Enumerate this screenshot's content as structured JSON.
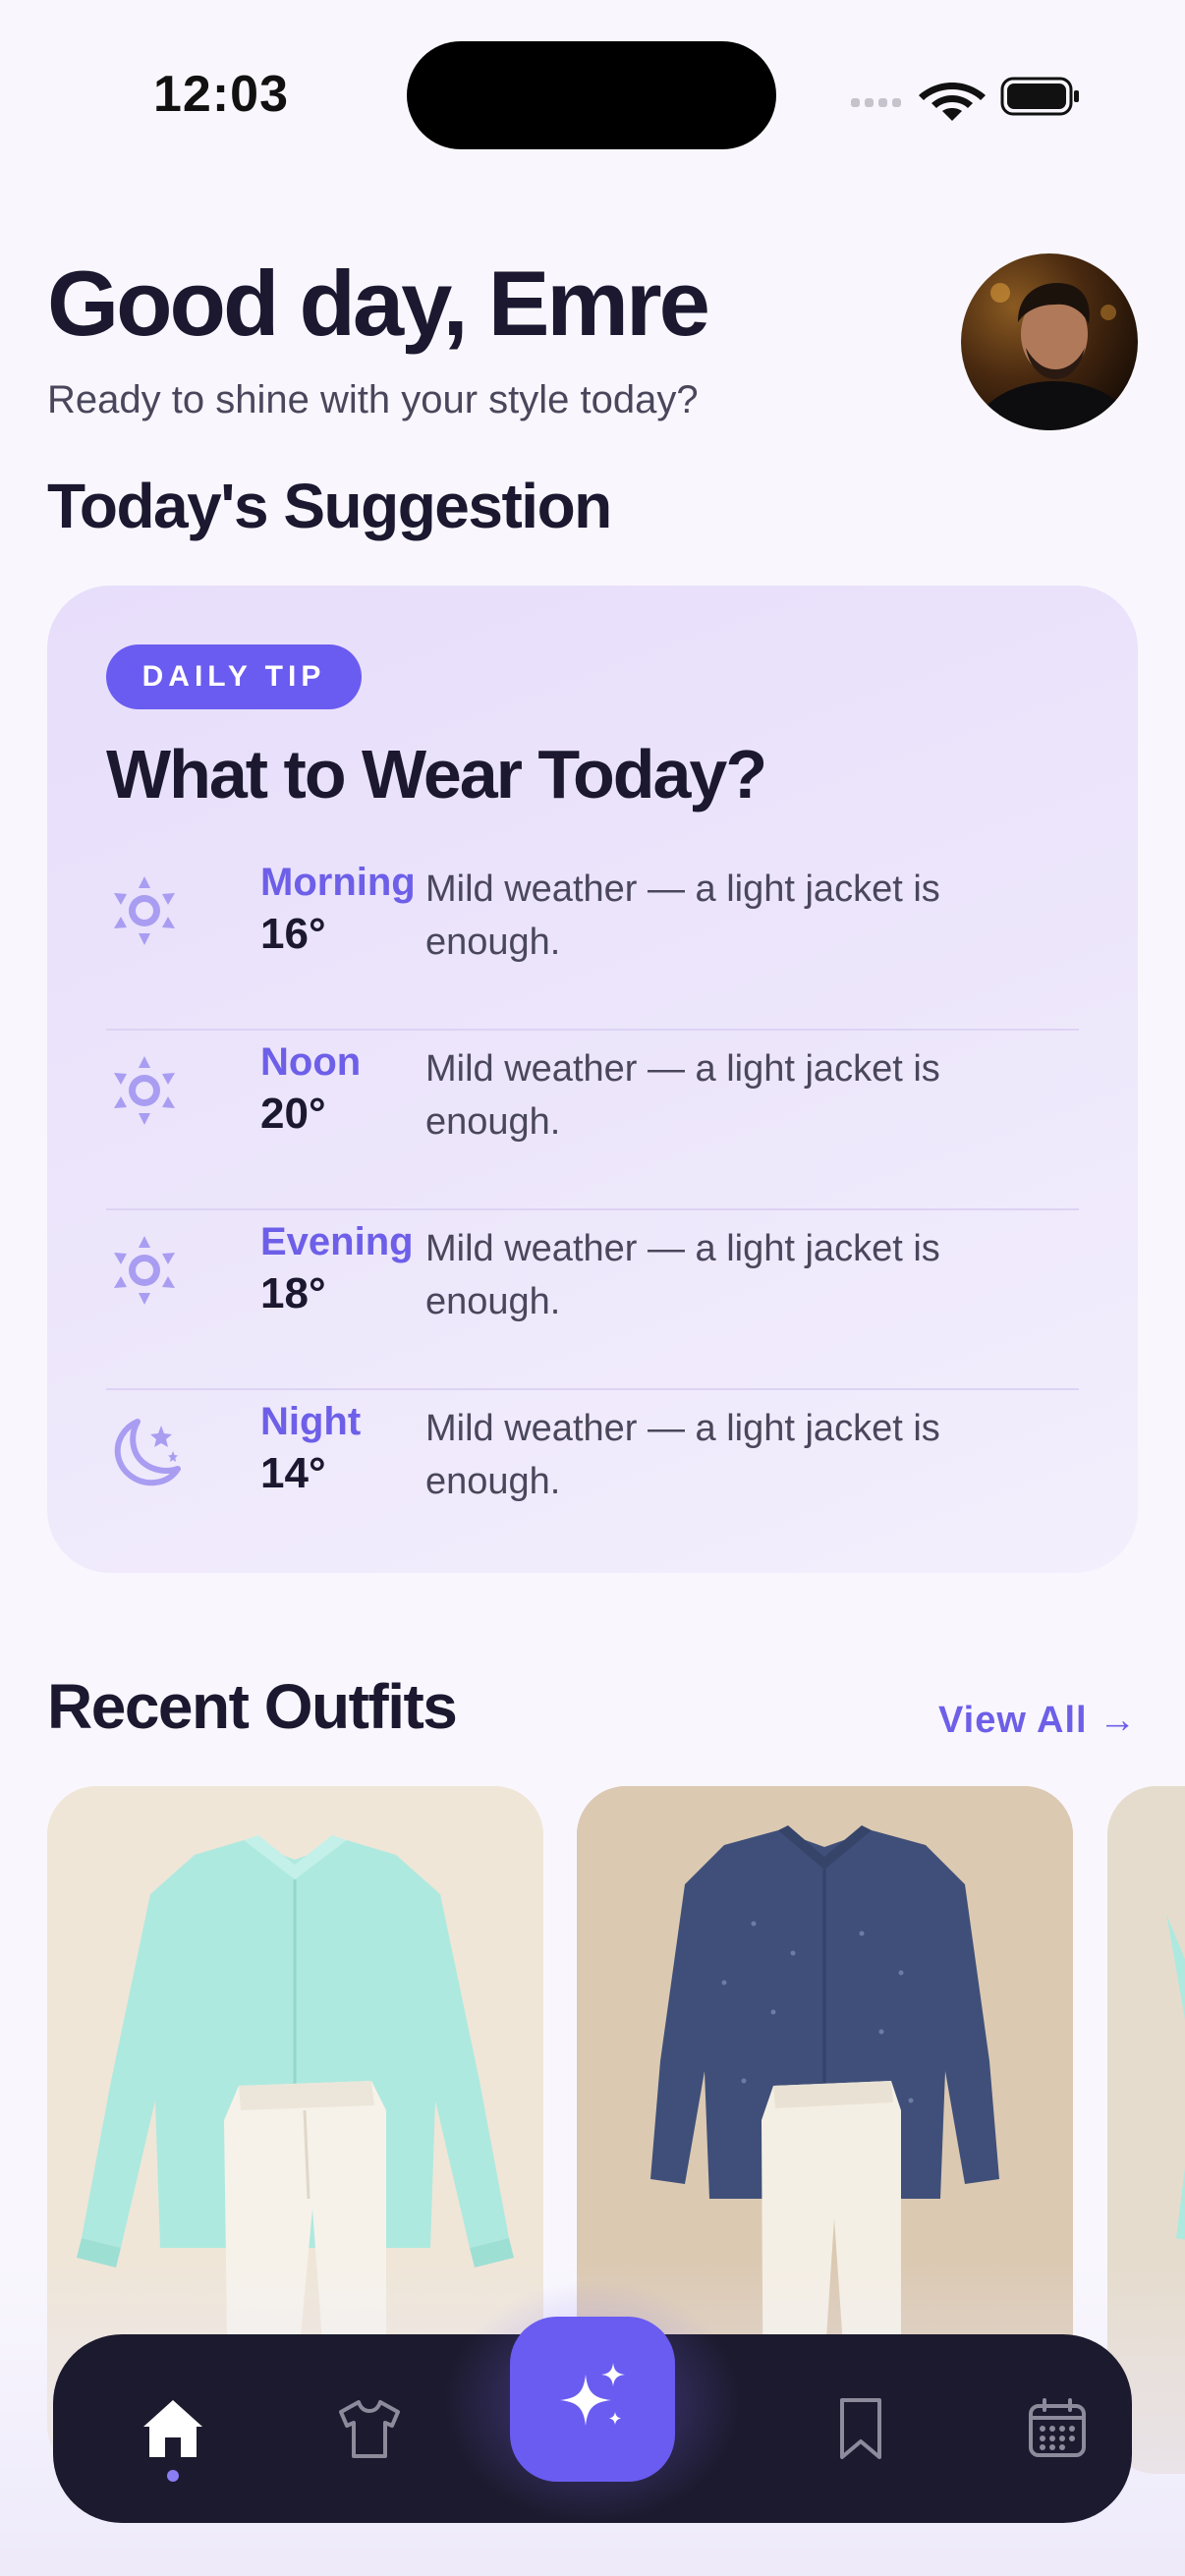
{
  "status_bar": {
    "time": "12:03"
  },
  "header": {
    "greeting": "Good day, Emre",
    "subtitle": "Ready to shine with your style today?"
  },
  "suggestion": {
    "section_title": "Today's Suggestion",
    "badge": "DAILY TIP",
    "card_title": "What to Wear Today?",
    "periods": [
      {
        "name": "Morning",
        "temp": "16°",
        "description": "Mild weather — a light jacket is enough.",
        "icon": "sun-icon"
      },
      {
        "name": "Noon",
        "temp": "20°",
        "description": "Mild weather — a light jacket is enough.",
        "icon": "sun-icon"
      },
      {
        "name": "Evening",
        "temp": "18°",
        "description": "Mild weather — a light jacket is enough.",
        "icon": "sun-icon"
      },
      {
        "name": "Night",
        "temp": "14°",
        "description": "Mild weather — a light jacket is enough.",
        "icon": "moon-stars-icon"
      }
    ]
  },
  "recent_outfits": {
    "section_title": "Recent Outfits",
    "view_all": "View All →"
  },
  "tab_bar": {
    "items": [
      "home-icon",
      "tshirt-icon",
      "sparkles-icon",
      "bookmark-icon",
      "calendar-icon"
    ],
    "active": "home-icon"
  },
  "colors": {
    "accent": "#6a5cf0",
    "accent_text": "#6d5fe8",
    "tab_bar_bg": "#1c1a2e",
    "card_bg": "#ece5fb",
    "page_bg": "#f9f7fd"
  }
}
